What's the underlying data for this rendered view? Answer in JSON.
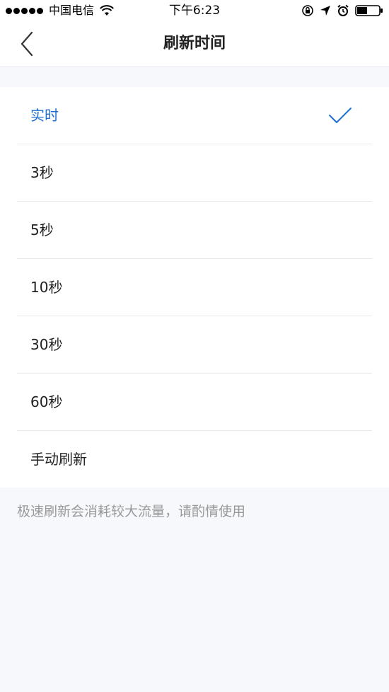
{
  "status_bar": {
    "carrier": "中国电信",
    "time": "下午6:23",
    "icons": [
      "signal-dots-icon",
      "wifi-icon",
      "orientation-lock-icon",
      "location-arrow-icon",
      "alarm-clock-icon",
      "battery-icon"
    ]
  },
  "nav": {
    "back_icon": "chevron-left-icon",
    "title": "刷新时间"
  },
  "options": [
    {
      "label": "实时",
      "selected": true
    },
    {
      "label": "3秒",
      "selected": false
    },
    {
      "label": "5秒",
      "selected": false
    },
    {
      "label": "10秒",
      "selected": false
    },
    {
      "label": "30秒",
      "selected": false
    },
    {
      "label": "60秒",
      "selected": false
    },
    {
      "label": "手动刷新",
      "selected": false
    }
  ],
  "footer": {
    "note": "极速刷新会消耗较大流量，请酌情使用"
  },
  "colors": {
    "accent": "#1d6fd1",
    "background": "#f7f8fb",
    "text": "#222222",
    "muted": "#999999"
  }
}
